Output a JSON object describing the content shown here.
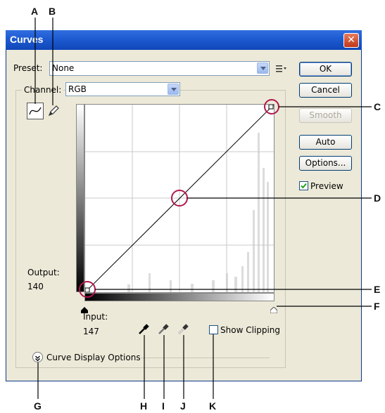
{
  "callouts": {
    "A": "A",
    "B": "B",
    "C": "C",
    "D": "D",
    "E": "E",
    "F": "F",
    "G": "G",
    "H": "H",
    "I": "I",
    "J": "J",
    "K": "K"
  },
  "dialog": {
    "title": "Curves",
    "preset_label": "Preset:",
    "preset_value": "None",
    "channel_label": "Channel:",
    "channel_value": "RGB",
    "output_label": "Output:",
    "output_value": "140",
    "input_label": "Input:",
    "input_value": "147",
    "show_clipping_label": "Show Clipping",
    "curve_display_options_label": "Curve Display Options",
    "buttons": {
      "ok": "OK",
      "cancel": "Cancel",
      "smooth": "Smooth",
      "auto": "Auto",
      "options": "Options..."
    },
    "preview_label": "Preview",
    "preview_checked": true,
    "show_clipping_checked": false
  },
  "colors": {
    "titlebar": "#1e5ad0",
    "callout_ring": "#b0174d",
    "dialog_bg": "#ece9d8"
  },
  "icons": [
    "curve-point-tool-icon",
    "pencil-icon",
    "preset-options-icon",
    "black-point-eyedropper-icon",
    "gray-point-eyedropper-icon",
    "white-point-eyedropper-icon",
    "expand-chevron-icon",
    "close-icon"
  ]
}
